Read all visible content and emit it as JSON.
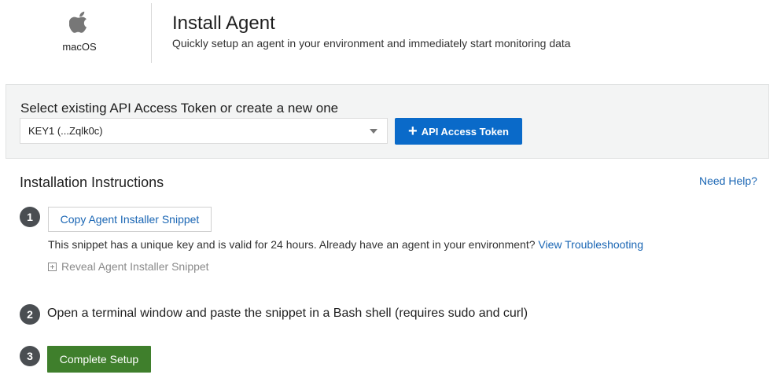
{
  "platform": {
    "icon": "apple-icon",
    "label": "macOS"
  },
  "header": {
    "title": "Install Agent",
    "subtitle": "Quickly setup an agent in your environment and immediately start monitoring data"
  },
  "token": {
    "heading": "Select existing API Access Token or create a new one",
    "selected": "KEY1 (...Zqlk0c)",
    "button_label": "API Access Token",
    "button_icon": "plus-icon",
    "button_color": "#0a6ac9"
  },
  "instructions": {
    "title": "Installation Instructions",
    "help_link": "Need Help?",
    "steps": [
      {
        "number": "1",
        "copy_button": "Copy Agent Installer Snippet",
        "note": "This snippet has a unique key and is valid for 24 hours. Already have an agent in your environment?",
        "note_link": "View Troubleshooting",
        "reveal_label": "Reveal Agent Installer Snippet"
      },
      {
        "number": "2",
        "text": "Open a terminal window and paste the snippet in a Bash shell (requires sudo and curl)"
      },
      {
        "number": "3",
        "button": "Complete Setup",
        "button_color": "#3f7f2c"
      }
    ]
  }
}
